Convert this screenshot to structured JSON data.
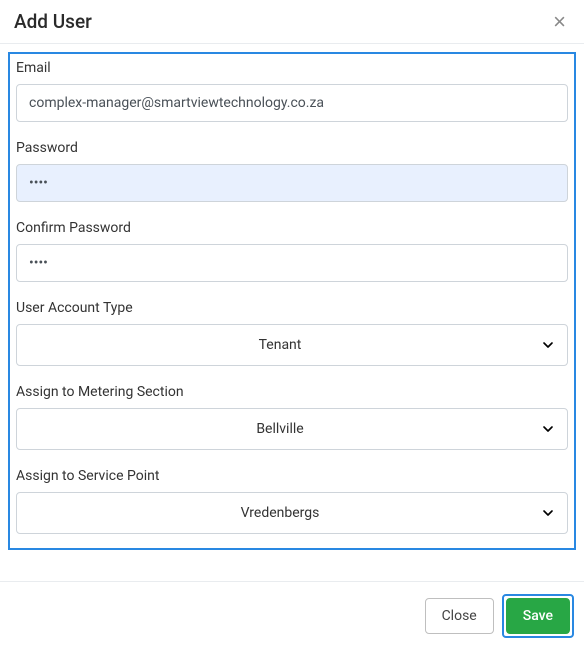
{
  "header": {
    "title": "Add User",
    "close_symbol": "×"
  },
  "form": {
    "email": {
      "label": "Email",
      "value": "complex-manager@smartviewtechnology.co.za"
    },
    "password": {
      "label": "Password",
      "value": "••••"
    },
    "confirm_password": {
      "label": "Confirm Password",
      "value": "••••"
    },
    "account_type": {
      "label": "User Account Type",
      "value": "Tenant"
    },
    "metering_section": {
      "label": "Assign to Metering Section",
      "value": "Bellville"
    },
    "service_point": {
      "label": "Assign to Service Point",
      "value": "Vredenbergs"
    }
  },
  "footer": {
    "close_label": "Close",
    "save_label": "Save"
  }
}
